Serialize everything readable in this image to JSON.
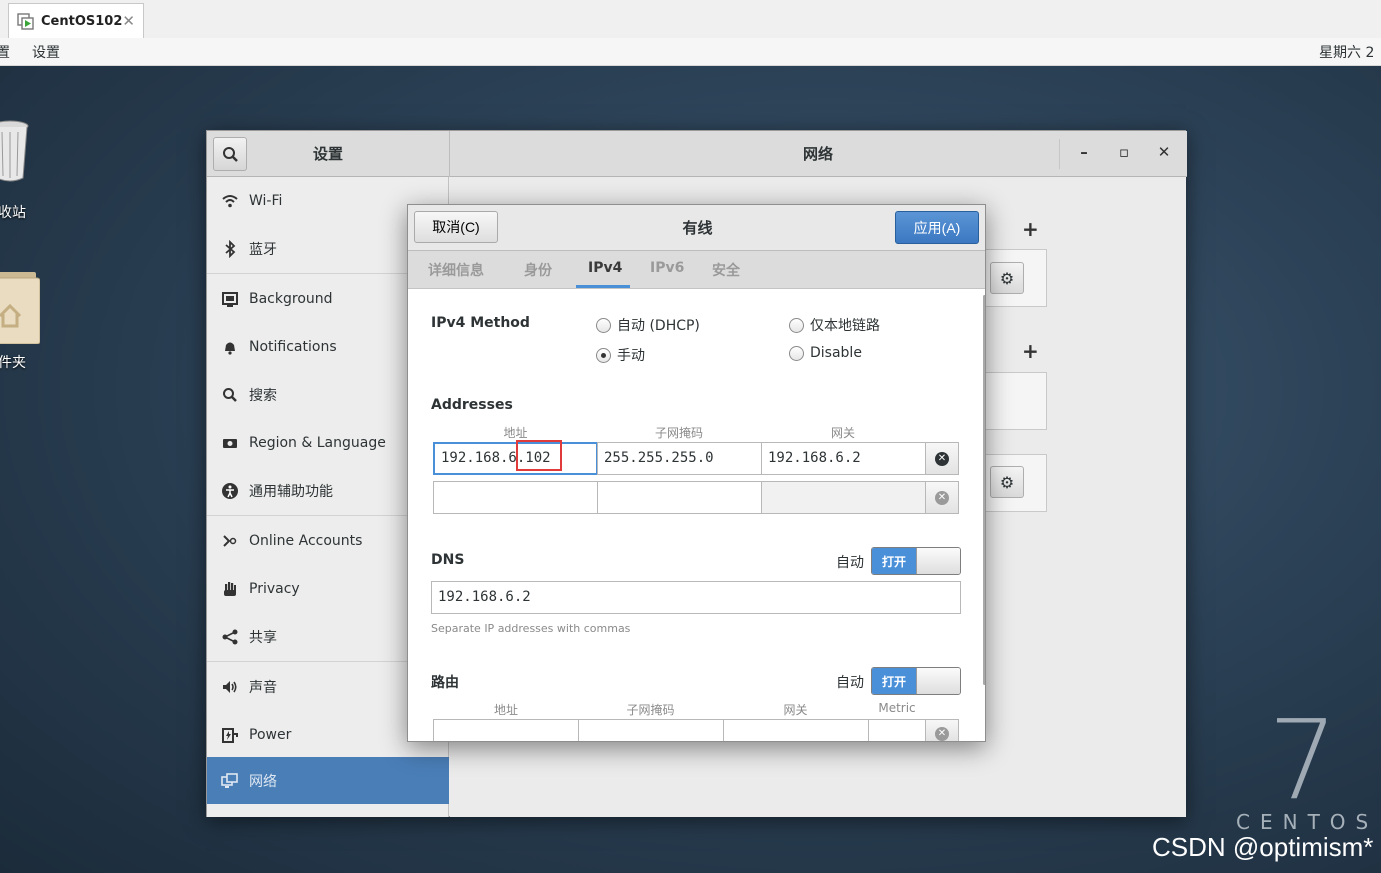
{
  "host": {
    "tab_title": "CentOS102",
    "tab_close": "✕"
  },
  "guest_topbar": {
    "menu_cut": "置",
    "menu_settings": "设置",
    "clock": "星期六 2"
  },
  "desktop": {
    "trash_label": "收站",
    "home_label": "件夹",
    "centos_number": "7",
    "centos_word": "CENTOS",
    "watermark": "CSDN @optimism*"
  },
  "settings": {
    "sidebar_title": "设置",
    "main_title": "网络",
    "window_controls": {
      "minimize": "–",
      "maximize": "▫",
      "close": "✕"
    },
    "sidebar_items": [
      {
        "label": "Wi-Fi",
        "icon": "wifi-icon"
      },
      {
        "label": "蓝牙",
        "icon": "bluetooth-icon"
      },
      {
        "label": "Background",
        "icon": "background-icon"
      },
      {
        "label": "Notifications",
        "icon": "bell-icon"
      },
      {
        "label": "搜索",
        "icon": "search-icon"
      },
      {
        "label": "Region & Language",
        "icon": "camera-icon"
      },
      {
        "label": "通用辅助功能",
        "icon": "accessibility-icon"
      },
      {
        "label": "Online Accounts",
        "icon": "online-accounts-icon"
      },
      {
        "label": "Privacy",
        "icon": "hand-icon"
      },
      {
        "label": "共享",
        "icon": "share-icon"
      },
      {
        "label": "声音",
        "icon": "speaker-icon"
      },
      {
        "label": "Power",
        "icon": "power-icon"
      },
      {
        "label": "网络",
        "icon": "network-icon"
      }
    ],
    "plus": "+",
    "gear": "⚙"
  },
  "dialog": {
    "cancel_label": "取消(C)",
    "title": "有线",
    "apply_label": "应用(A)",
    "tabs": [
      "详细信息",
      "身份",
      "IPv4",
      "IPv6",
      "安全"
    ],
    "active_tab": "IPv4",
    "ipv4_method_label": "IPv4 Method",
    "methods": {
      "auto_dhcp": "自动 (DHCP)",
      "link_local": "仅本地链路",
      "manual": "手动",
      "disable": "Disable"
    },
    "selected_method": "manual",
    "addresses_label": "Addresses",
    "address_columns": [
      "地址",
      "子网掩码",
      "网关"
    ],
    "address_rows": [
      {
        "address": "192.168.6.102",
        "netmask": "255.255.255.0",
        "gateway": "192.168.6.2"
      },
      {
        "address": "",
        "netmask": "",
        "gateway": ""
      }
    ],
    "dns_label": "DNS",
    "auto_label": "自动",
    "switch_on_label": "打开",
    "dns_value": "192.168.6.2",
    "dns_hint": "Separate IP addresses with commas",
    "routes_label": "路由",
    "route_columns": [
      "地址",
      "子网掩码",
      "网关",
      "Metric"
    ]
  }
}
